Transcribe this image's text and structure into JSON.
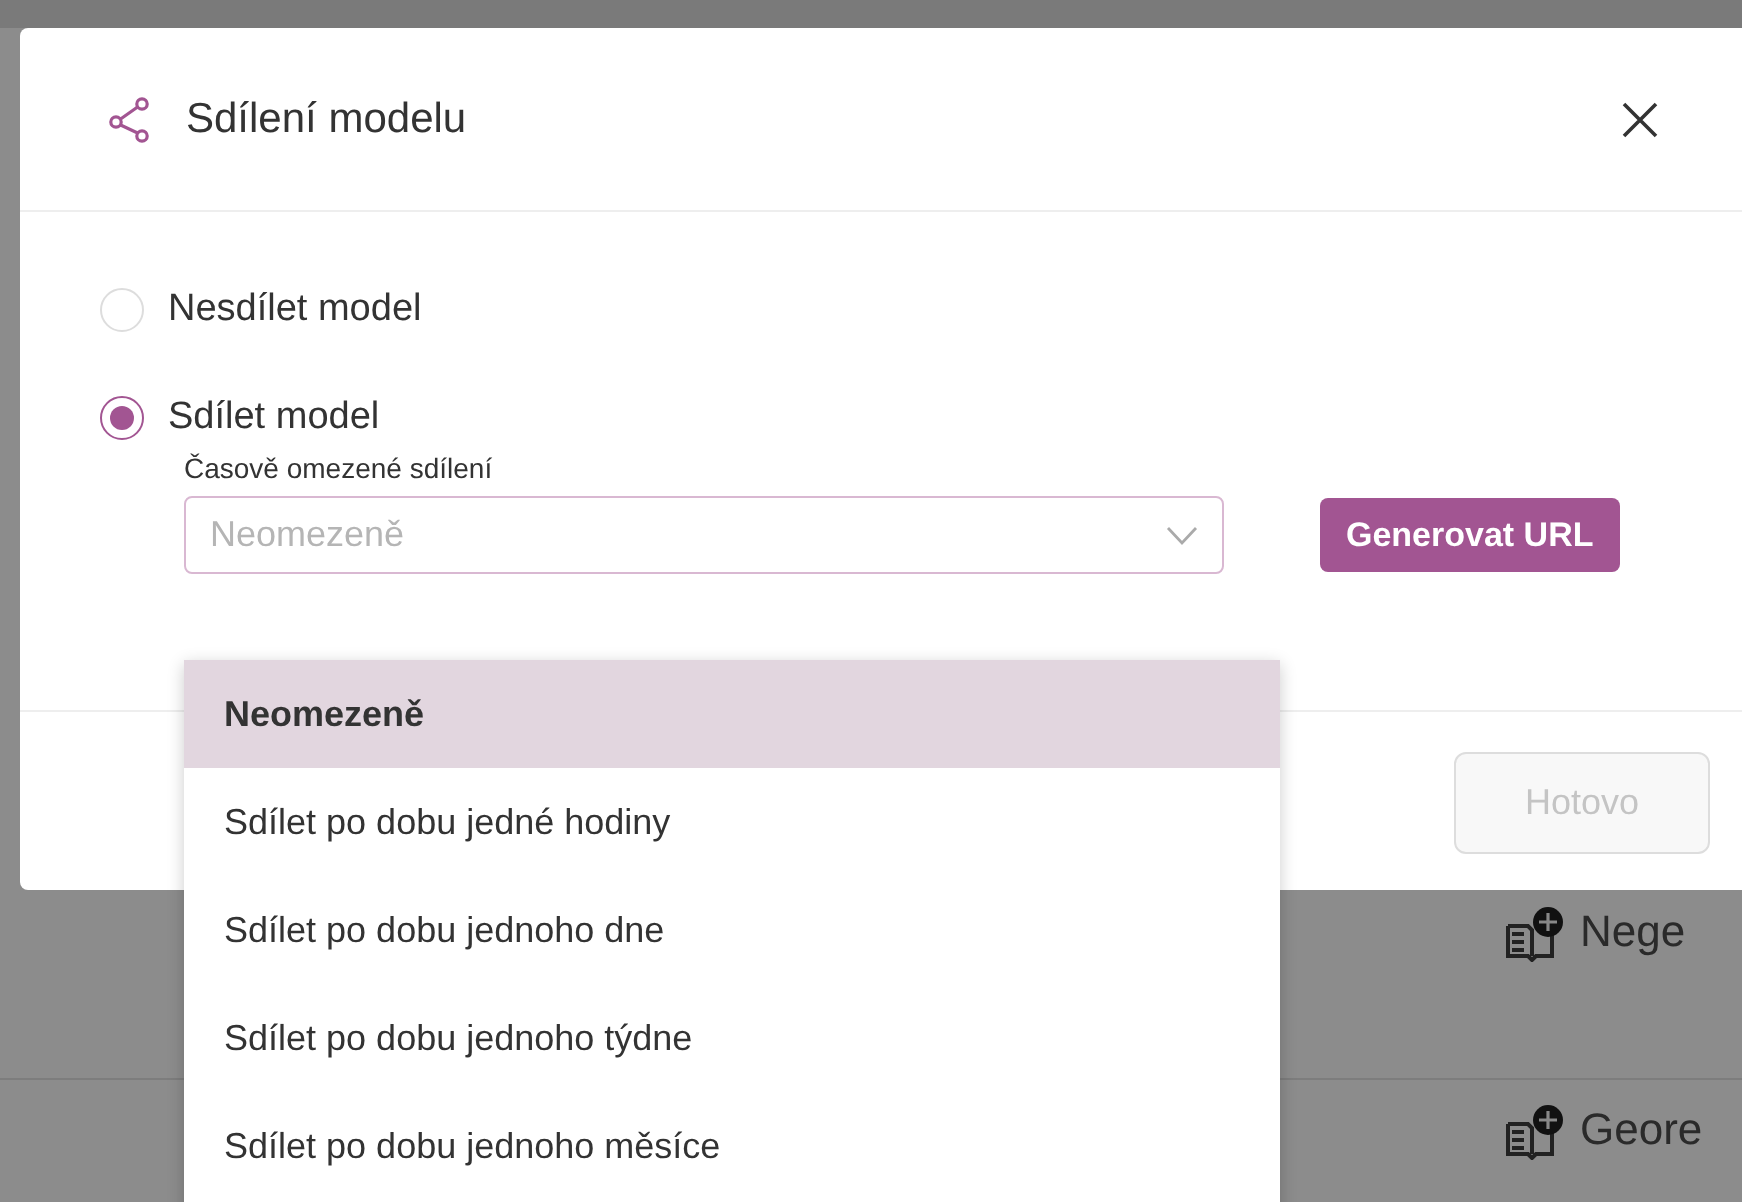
{
  "background_list": {
    "rows": [
      {
        "label": "Nege"
      },
      {
        "label": "Geore"
      }
    ]
  },
  "dialog": {
    "title": "Sdílení modelu",
    "options": [
      {
        "label": "Nesdílet model",
        "selected": false
      },
      {
        "label": "Sdílet model",
        "selected": true
      }
    ],
    "duration": {
      "label": "Časově omezené sdílení",
      "placeholder": "Neomezeně",
      "expanded": true
    },
    "generate_button": "Generovat URL",
    "done_button": {
      "label": "Hotovo",
      "disabled": true
    }
  },
  "dropdown": {
    "items": [
      {
        "label": "Neomezeně",
        "selected": true
      },
      {
        "label": "Sdílet po dobu jedné hodiny",
        "selected": false
      },
      {
        "label": "Sdílet po dobu jednoho dne",
        "selected": false
      },
      {
        "label": "Sdílet po dobu jednoho týdne",
        "selected": false
      },
      {
        "label": "Sdílet po dobu jednoho měsíce",
        "selected": false
      }
    ]
  }
}
